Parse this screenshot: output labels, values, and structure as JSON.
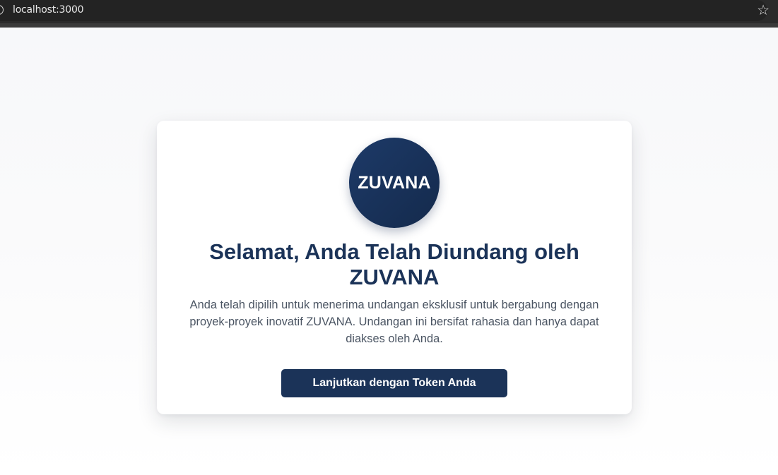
{
  "browser": {
    "url": "localhost:3000",
    "info_icon": "info-icon",
    "bookmark_icon": "star-outline-icon"
  },
  "card": {
    "logo_text": "ZUVANA",
    "title": "Selamat, Anda Telah Diundang oleh ZUVANA",
    "description": "Anda telah dipilih untuk menerima undangan eksklusif untuk bergabung dengan proyek-proyek inovatif ZUVANA. Undangan ini bersifat rahasia dan hanya dapat diakses oleh Anda.",
    "button_label": "Lanjutkan dengan Token Anda"
  },
  "colors": {
    "brand_navy": "#1b3358",
    "text_muted": "#4b5563",
    "page_background": "#f7f8fa"
  }
}
